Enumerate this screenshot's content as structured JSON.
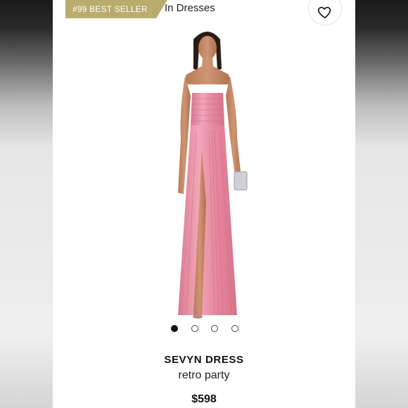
{
  "badge": {
    "label": "#99 BEST SELLER",
    "color": "#b9ac6c"
  },
  "category": {
    "label": "In Dresses"
  },
  "wishlist": {
    "icon": "heart-icon"
  },
  "gallery": {
    "active_index": 0,
    "count": 4
  },
  "product": {
    "name": "SEVYN DRESS",
    "brand": "retro party",
    "price": "$598",
    "dress_color": "#e98fa6"
  }
}
